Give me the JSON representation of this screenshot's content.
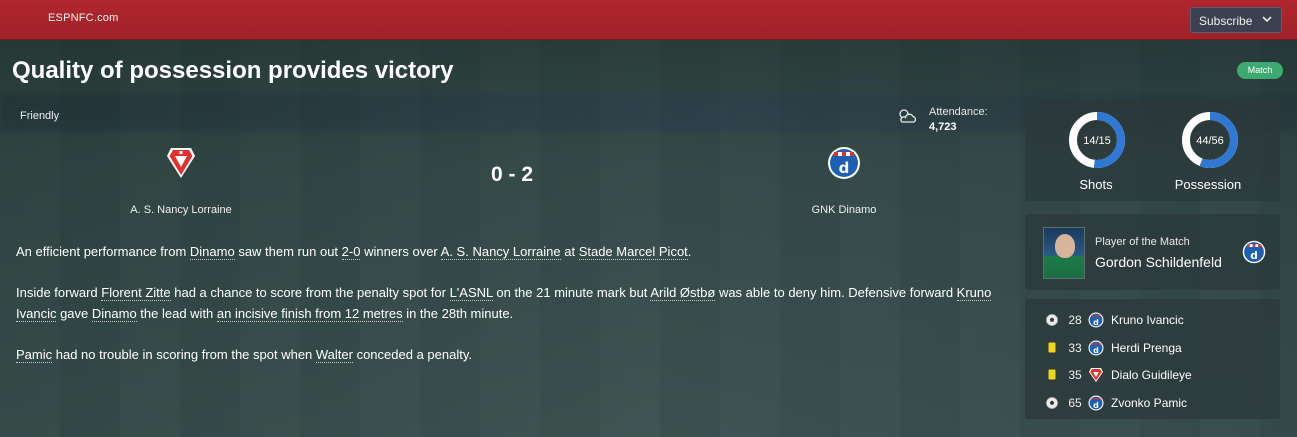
{
  "topbar": {
    "brand": "ESPNFC.com",
    "subscribe_label": "Subscribe"
  },
  "article": {
    "headline": "Quality of possession provides victory",
    "tag": "Match",
    "paragraphs": [
      [
        {
          "t": "An efficient performance from "
        },
        {
          "t": "Dinamo",
          "link": true
        },
        {
          "t": " saw them run out "
        },
        {
          "t": "2-0",
          "link": true
        },
        {
          "t": " winners over "
        },
        {
          "t": "A. S. Nancy Lorraine",
          "link": true
        },
        {
          "t": " at "
        },
        {
          "t": "Stade Marcel Picot",
          "link": true
        },
        {
          "t": "."
        }
      ],
      [
        {
          "t": "Inside forward "
        },
        {
          "t": "Florent Zitte",
          "link": true
        },
        {
          "t": " had a chance to score from the penalty spot for "
        },
        {
          "t": "L'ASNL",
          "link": true
        },
        {
          "t": " on the 21 minute mark but "
        },
        {
          "t": "Arild Østbø",
          "link": true
        },
        {
          "t": " was able to deny him. Defensive forward "
        },
        {
          "t": "Kruno Ivancic",
          "link": true
        },
        {
          "t": " gave "
        },
        {
          "t": "Dinamo",
          "link": true
        },
        {
          "t": " the lead with "
        },
        {
          "t": "an incisive finish from 12 metres",
          "link": true
        },
        {
          "t": " in the 28th minute."
        }
      ],
      [
        {
          "t": "Pamic",
          "link": true
        },
        {
          "t": " had no trouble in scoring from the spot when "
        },
        {
          "t": "Walter",
          "link": true
        },
        {
          "t": " conceded a penalty."
        }
      ]
    ]
  },
  "match": {
    "competition": "Friendly",
    "weather_icon": "partly-cloudy-icon",
    "attendance_label": "Attendance:",
    "attendance_value": "4,723",
    "home": {
      "name": "A. S. Nancy Lorraine",
      "crest_color": "#e3312f"
    },
    "away": {
      "name": "GNK Dinamo",
      "crest_color": "#1d5fb0"
    },
    "score": "0 - 2"
  },
  "stats": {
    "shots": {
      "label": "Shots",
      "text": "14/15",
      "home": 14,
      "away": 15
    },
    "possession": {
      "label": "Possession",
      "text": "44/56",
      "home": 44,
      "away": 56
    },
    "colors": {
      "home": "#ffffff",
      "away": "#2f78d4"
    }
  },
  "player_of_match": {
    "label": "Player of the Match",
    "name": "Gordon Schildenfeld",
    "team": "away"
  },
  "events": [
    {
      "icon": "ball-icon",
      "minute": "28",
      "team": "away",
      "player": "Kruno Ivancic"
    },
    {
      "icon": "yellow-card-icon",
      "minute": "33",
      "team": "away",
      "player": "Herdi Prenga"
    },
    {
      "icon": "yellow-card-icon",
      "minute": "35",
      "team": "home",
      "player": "Dialo Guidileye"
    },
    {
      "icon": "ball-icon",
      "minute": "65",
      "team": "away",
      "player": "Zvonko Pamic"
    }
  ]
}
